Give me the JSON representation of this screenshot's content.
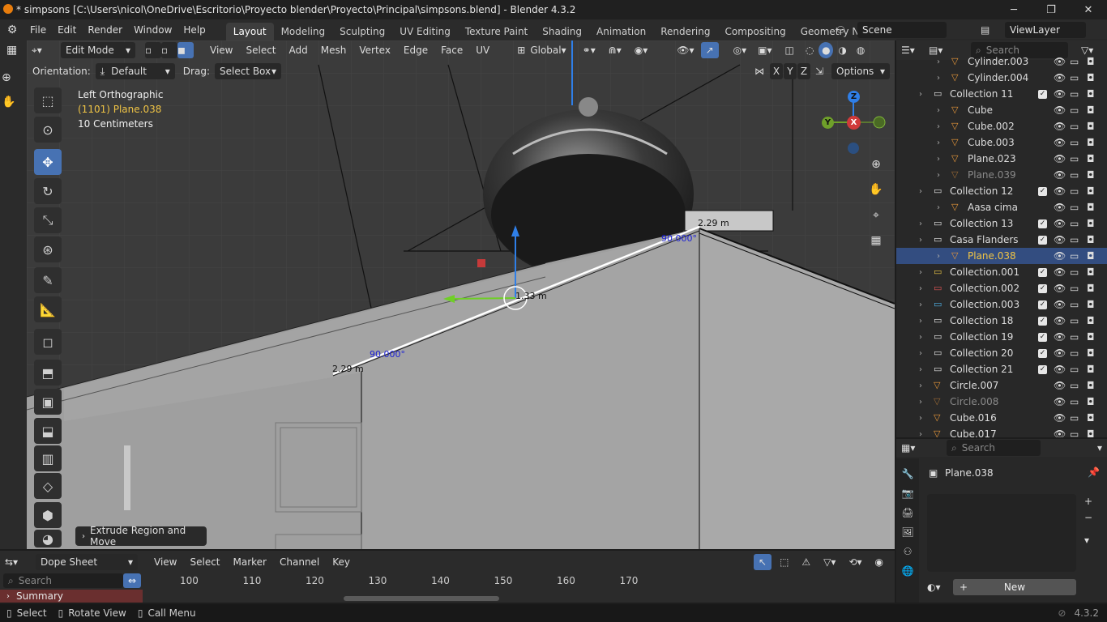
{
  "window": {
    "title": "* simpsons [C:\\Users\\nicol\\OneDrive\\Escritorio\\Proyecto blender\\Proyecto\\Principal\\simpsons.blend] - Blender 4.3.2",
    "minimize": "─",
    "maximize": "❐",
    "close": "✕"
  },
  "menu": [
    "File",
    "Edit",
    "Render",
    "Window",
    "Help"
  ],
  "workspaces": [
    "Layout",
    "Modeling",
    "Sculpting",
    "UV Editing",
    "Texture Paint",
    "Shading",
    "Animation",
    "Rendering",
    "Compositing",
    "Geometry Node"
  ],
  "scene": {
    "name": "Scene",
    "view_layer": "ViewLayer"
  },
  "viewport_header": {
    "mode": "Edit Mode",
    "menus": [
      "View",
      "Select",
      "Add",
      "Mesh",
      "Vertex",
      "Edge",
      "Face",
      "UV"
    ],
    "transform": "Global"
  },
  "tool_settings": {
    "orientation_label": "Orientation:",
    "orientation_value": "Default",
    "drag_label": "Drag:",
    "drag_value": "Select Box",
    "options": "Options",
    "axes": [
      "X",
      "Y",
      "Z"
    ]
  },
  "viewport_info": {
    "view": "Left Orthographic",
    "object": "(1101) Plane.038",
    "scale": "10 Centimeters"
  },
  "measurements": {
    "len_top": "2.29 m",
    "angle_top": "90.000°",
    "len_mid": "1.33 m",
    "angle_bottom": "90.000°",
    "len_bottom": "2.29 m"
  },
  "gizmo": {
    "z": "Z",
    "y": "Y",
    "x": "X"
  },
  "last_op": "Extrude Region and Move",
  "outliner": {
    "search_placeholder": "Search",
    "rows": [
      {
        "name": "Cylinder.003",
        "indent": 2,
        "dim": false,
        "sel": false
      },
      {
        "name": "Cylinder.004",
        "indent": 2,
        "dim": false,
        "sel": false
      },
      {
        "name": "Collection 11",
        "indent": 1,
        "dim": false,
        "sel": false,
        "coll": true
      },
      {
        "name": "Cube",
        "indent": 2,
        "dim": false,
        "sel": false
      },
      {
        "name": "Cube.002",
        "indent": 2,
        "dim": false,
        "sel": false
      },
      {
        "name": "Cube.003",
        "indent": 2,
        "dim": false,
        "sel": false
      },
      {
        "name": "Plane.023",
        "indent": 2,
        "dim": false,
        "sel": false
      },
      {
        "name": "Plane.039",
        "indent": 2,
        "dim": true,
        "sel": false
      },
      {
        "name": "Collection 12",
        "indent": 1,
        "dim": false,
        "sel": false,
        "coll": true
      },
      {
        "name": "Aasa cima",
        "indent": 2,
        "dim": false,
        "sel": false
      },
      {
        "name": "Collection 13",
        "indent": 1,
        "dim": false,
        "sel": false,
        "coll": true
      },
      {
        "name": "Casa Flanders",
        "indent": 1,
        "dim": false,
        "sel": false,
        "coll": true
      },
      {
        "name": "Plane.038",
        "indent": 2,
        "dim": false,
        "sel": true
      },
      {
        "name": "Collection.001",
        "indent": 1,
        "dim": false,
        "sel": false,
        "coll": true,
        "color": "#e8c545"
      },
      {
        "name": "Collection.002",
        "indent": 1,
        "dim": false,
        "sel": false,
        "coll": true,
        "color": "#e05555"
      },
      {
        "name": "Collection.003",
        "indent": 1,
        "dim": false,
        "sel": false,
        "coll": true,
        "color": "#4fb3e8"
      },
      {
        "name": "Collection 18",
        "indent": 1,
        "dim": false,
        "sel": false,
        "coll": true
      },
      {
        "name": "Collection 19",
        "indent": 1,
        "dim": false,
        "sel": false,
        "coll": true
      },
      {
        "name": "Collection 20",
        "indent": 1,
        "dim": false,
        "sel": false,
        "coll": true
      },
      {
        "name": "Collection 21",
        "indent": 1,
        "dim": false,
        "sel": false,
        "coll": true
      },
      {
        "name": "Circle.007",
        "indent": 1,
        "dim": false,
        "sel": false
      },
      {
        "name": "Circle.008",
        "indent": 1,
        "dim": true,
        "sel": false
      },
      {
        "name": "Cube.016",
        "indent": 1,
        "dim": false,
        "sel": false
      },
      {
        "name": "Cube.017",
        "indent": 1,
        "dim": false,
        "sel": false
      }
    ]
  },
  "properties": {
    "search_placeholder": "Search",
    "object": "Plane.038",
    "new_button": "New"
  },
  "dope_sheet": {
    "mode": "Dope Sheet",
    "menus": [
      "View",
      "Select",
      "Marker",
      "Channel",
      "Key"
    ],
    "search_placeholder": "Search",
    "frames": [
      "100",
      "110",
      "120",
      "130",
      "140",
      "150",
      "160",
      "170"
    ],
    "summary": "Summary"
  },
  "status_bar": {
    "select": "Select",
    "rotate": "Rotate View",
    "call_menu": "Call Menu",
    "version": "4.3.2"
  },
  "colors": {
    "accent": "#4772b3",
    "selected_row": "#334d80",
    "object_orange": "#e8973a",
    "active_text": "#f0c445"
  }
}
